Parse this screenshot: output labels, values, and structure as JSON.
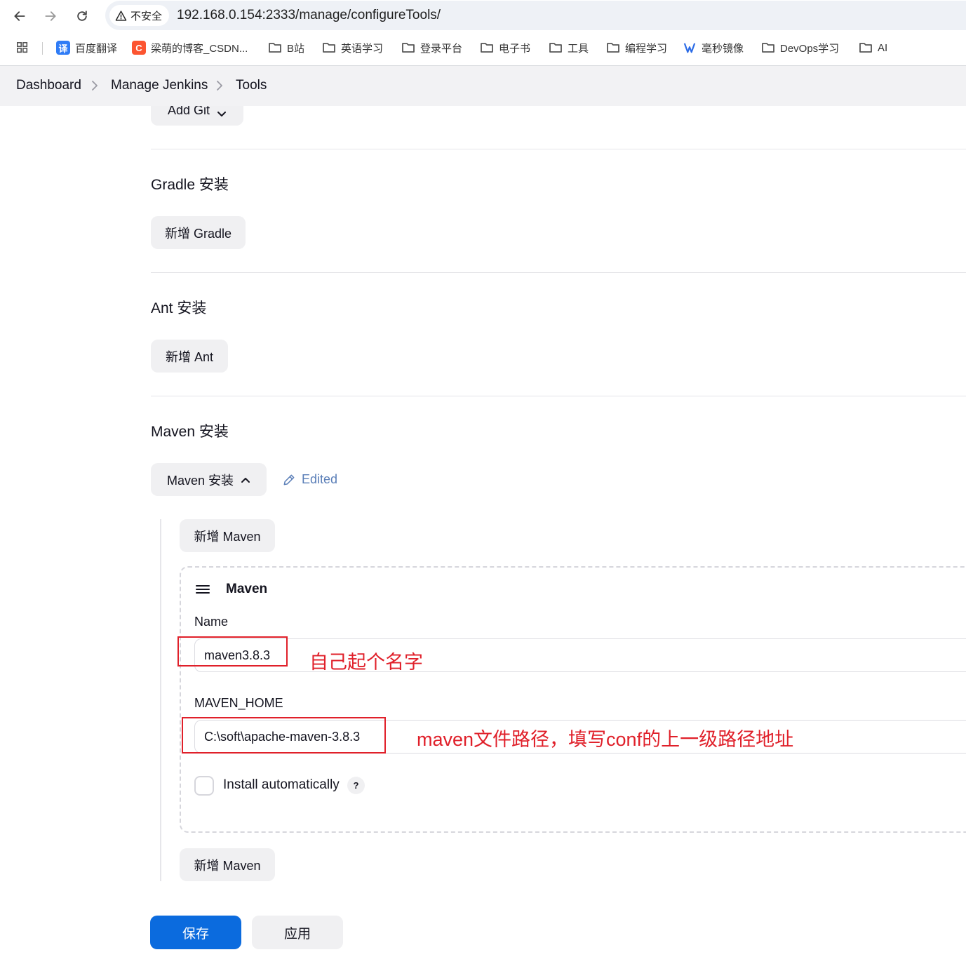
{
  "browser": {
    "security_label": "不安全",
    "url": "192.168.0.154:2333/manage/configureTools/",
    "bookmarks": [
      {
        "label": "百度翻译",
        "icon": "baidu-translate-icon",
        "color": "#2f7cf6"
      },
      {
        "label": "梁萌的博客_CSDN...",
        "icon": "csdn-icon",
        "color": "#fc5531"
      },
      {
        "label": "B站",
        "icon": "folder-icon"
      },
      {
        "label": "英语学习",
        "icon": "folder-icon"
      },
      {
        "label": "登录平台",
        "icon": "folder-icon"
      },
      {
        "label": "电子书",
        "icon": "folder-icon"
      },
      {
        "label": "工具",
        "icon": "folder-icon"
      },
      {
        "label": "编程学习",
        "icon": "folder-icon"
      },
      {
        "label": "毫秒镜像",
        "icon": "mirror-logo-icon",
        "color": "#2b6be6"
      },
      {
        "label": "DevOps学习",
        "icon": "folder-icon"
      },
      {
        "label": "AI",
        "icon": "folder-icon"
      }
    ]
  },
  "breadcrumb": {
    "items": [
      "Dashboard",
      "Manage Jenkins",
      "Tools"
    ]
  },
  "git": {
    "add_button": "Add Git"
  },
  "gradle": {
    "title": "Gradle 安装",
    "add_button": "新增 Gradle"
  },
  "ant": {
    "title": "Ant 安装",
    "add_button": "新增 Ant"
  },
  "maven": {
    "title": "Maven 安装",
    "toggle_button": "Maven 安装",
    "edited_label": "Edited",
    "add_button_top": "新增 Maven",
    "add_button_bottom": "新增 Maven",
    "card": {
      "title": "Maven",
      "name_label": "Name",
      "name_value": "maven3.8.3",
      "home_label": "MAVEN_HOME",
      "home_value": "C:\\soft\\apache-maven-3.8.3",
      "install_auto_label": "Install automatically",
      "install_auto_checked": false,
      "help_label": "?"
    }
  },
  "annotations": {
    "name_note": "自己起个名字",
    "home_note": "maven文件路径，填写conf的上一级路径地址",
    "color": "#e0202a"
  },
  "actions": {
    "save": "保存",
    "apply": "应用",
    "primary_color": "#0b6bde"
  }
}
